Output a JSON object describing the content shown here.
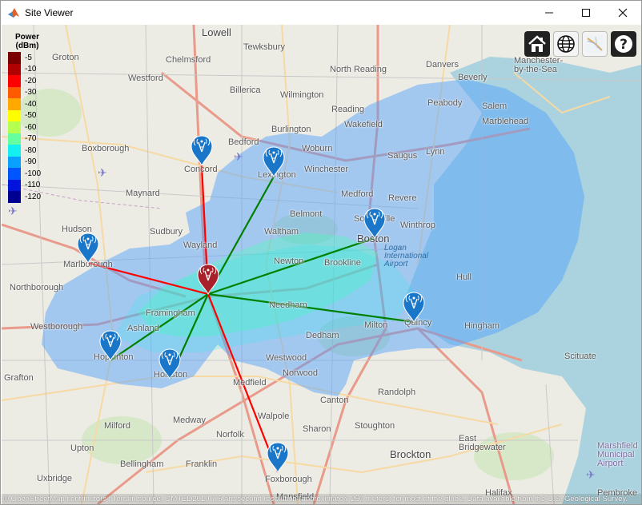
{
  "window": {
    "title": "Site Viewer",
    "minimize_label": "—",
    "maximize_label": "☐",
    "close_label": "✕"
  },
  "legend": {
    "title_line1": "Power",
    "title_line2": "(dBm)",
    "items": [
      {
        "label": "-5",
        "color": "#7a0000"
      },
      {
        "label": "-10",
        "color": "#b00000"
      },
      {
        "label": "-20",
        "color": "#ff0000"
      },
      {
        "label": "-30",
        "color": "#ff5a00"
      },
      {
        "label": "-40",
        "color": "#ffa800"
      },
      {
        "label": "-50",
        "color": "#ffff00"
      },
      {
        "label": "-60",
        "color": "#b4ff50"
      },
      {
        "label": "-70",
        "color": "#66ffa0"
      },
      {
        "label": "-80",
        "color": "#14f0f0"
      },
      {
        "label": "-90",
        "color": "#0aa0ff"
      },
      {
        "label": "-100",
        "color": "#0055ff"
      },
      {
        "label": "-110",
        "color": "#0014dc"
      },
      {
        "label": "-120",
        "color": "#000090"
      }
    ]
  },
  "toolbar": {
    "home_icon": "home-icon",
    "basemap_icon": "globe-icon",
    "terrain_icon": "terrain-icon",
    "help_icon": "help-icon",
    "help_label": "?"
  },
  "sites": {
    "transmitter": {
      "name": "Framingham transmitter",
      "color": "#a8202a"
    },
    "receiver_color": "#1976c8",
    "receivers": [
      "Concord",
      "Lexington",
      "Boston",
      "Marlborough",
      "Hopkinton",
      "Holliston",
      "Quincy",
      "Foxborough"
    ],
    "link_ok_color": "#008000",
    "link_fail_color": "#ff0000"
  },
  "places": {
    "lowell": "Lowell",
    "tewksbury": "Tewksbury",
    "groton": "Groton",
    "chelmsford": "Chelmsford",
    "westford": "Westford",
    "billerica": "Billerica",
    "north_reading": "North Reading",
    "danvers": "Danvers",
    "beverly": "Beverly",
    "manchester": "Manchester-by-the-Sea",
    "wilmington": "Wilmington",
    "reading": "Reading",
    "peabody": "Peabody",
    "salem": "Salem",
    "marblehead": "Marblehead",
    "bedford": "Bedford",
    "burlington": "Burlington",
    "wakefield": "Wakefield",
    "boxborough": "Boxborough",
    "concord": "Concord",
    "lexington": "Lexington",
    "woburn": "Woburn",
    "saugus": "Saugus",
    "lynn": "Lynn",
    "maynard": "Maynard",
    "winchester": "Winchester",
    "medford": "Medford",
    "revere": "Revere",
    "hudson": "Hudson",
    "sudbury": "Sudbury",
    "belmont": "Belmont",
    "somerville": "Somerville",
    "winthrop": "Winthrop",
    "waltham": "Waltham",
    "boston": "Boston",
    "marlborough": "Marlborough",
    "wayland": "Wayland",
    "newton": "Newton",
    "brookline": "Brookline",
    "logan": "Logan International Airport",
    "northborough": "Northborough",
    "framingham": "Framingham",
    "needham": "Needham",
    "hull": "Hull",
    "westborough": "Westborough",
    "ashland": "Ashland",
    "milton": "Milton",
    "quincy": "Quincy",
    "hingham": "Hingham",
    "hopkinton": "Hopkinton",
    "dedham": "Dedham",
    "holliston": "Holliston",
    "westwood": "Westwood",
    "scituate": "Scituate",
    "grafton": "Grafton",
    "medfield": "Medfield",
    "norwood": "Norwood",
    "canton": "Canton",
    "randolph": "Randolph",
    "milford": "Milford",
    "medway": "Medway",
    "walpole": "Walpole",
    "norfolk": "Norfolk",
    "sharon": "Sharon",
    "stoughton": "Stoughton",
    "east_bridgewater": "East Bridgewater",
    "upton": "Upton",
    "bellingham": "Bellingham",
    "franklin": "Franklin",
    "brockton": "Brockton",
    "marshfield": "Marshfield Municipal Airport",
    "uxbridge": "Uxbridge",
    "foxborough": "Foxborough",
    "mansfield": "Mansfield",
    "halifax": "Halifax",
    "pembroke": "Pembroke"
  },
  "attribution": {
    "osm": "© OpenStreetMap contributors",
    "rest": " | Terrain source: GMTED2010 7.5 arc-second resolution (approximately 250 meters) for most of the globe. Data available from the U.S. Geological Survey."
  }
}
